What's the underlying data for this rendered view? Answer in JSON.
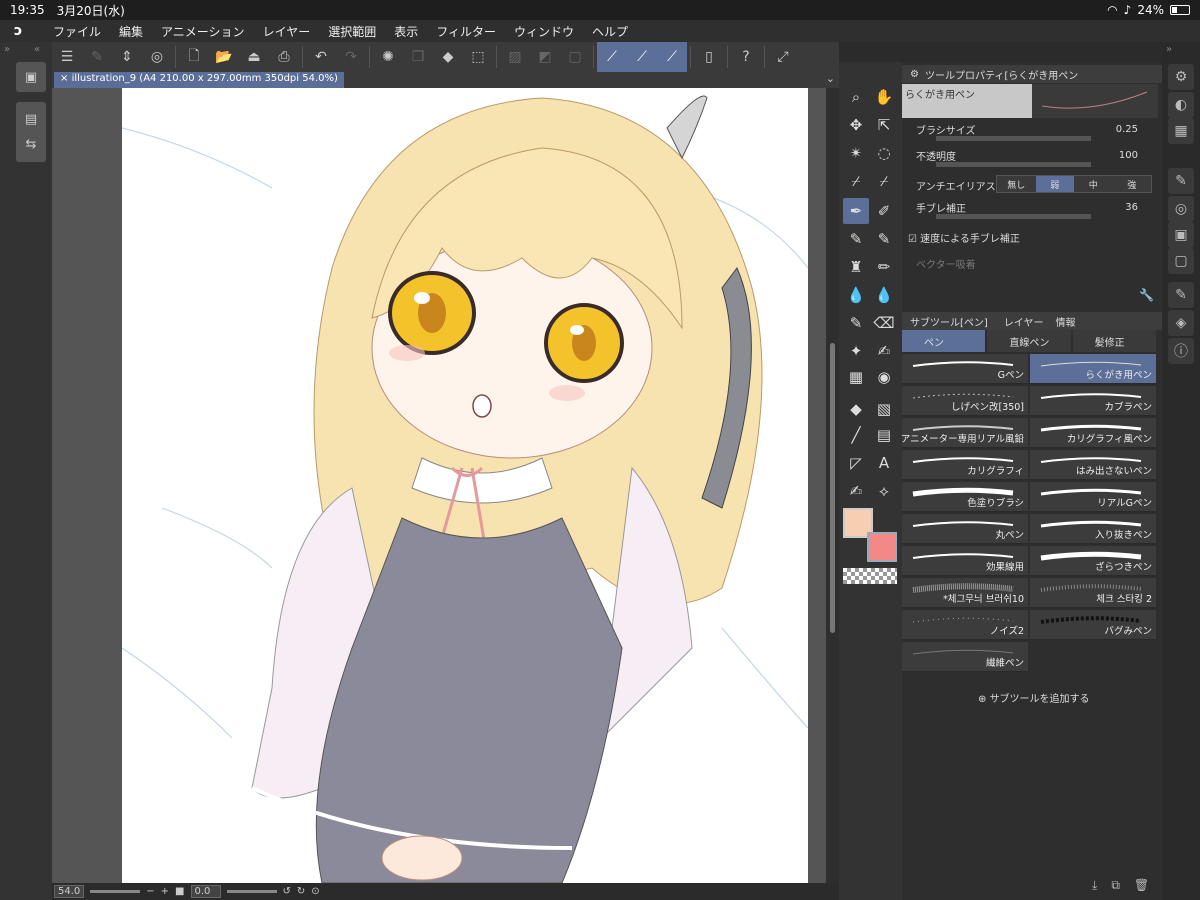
{
  "status": {
    "time": "19:35",
    "date": "3月20日(水)",
    "battery": "24%"
  },
  "menu": [
    "ファイル",
    "編集",
    "アニメーション",
    "レイヤー",
    "選択範囲",
    "表示",
    "フィルター",
    "ウィンドウ",
    "ヘルプ"
  ],
  "document": {
    "tab_label": "illustration_9 (A4 210.00 x 297.00mm 350dpi 54.0%)"
  },
  "bottom": {
    "zoom": "54.0",
    "angle": "0.0"
  },
  "tool_property": {
    "title": "ツールプロパティ[らくがき用ペン",
    "preset_name": "らくがき用ペン",
    "brush_size_label": "ブラシサイズ",
    "brush_size_value": "0.25",
    "opacity_label": "不透明度",
    "opacity_value": "100",
    "antialias_label": "アンチエイリアス",
    "antialias_options": [
      "無し",
      "弱",
      "中",
      "強"
    ],
    "stabilization_label": "手ブレ補正",
    "stabilization_value": "36",
    "speed_stab_label": "速度による手ブレ補正",
    "vector_snap_label": "ベクター吸着"
  },
  "subtool": {
    "header": "サブツール[ペン]",
    "layer_tab": "レイヤー",
    "info_tab": "情報",
    "tabs": [
      "ペン",
      "直線ペン",
      "髪修正"
    ],
    "brushes": [
      "Gペン",
      "らくがき用ペン",
      "しげペン改[350]",
      "カブラペン",
      "アニメーター専用リアル風鉛",
      "カリグラフィ風ペン",
      "カリグラフィ",
      "はみ出さないペン",
      "色塗りブラシ",
      "リアルGペン",
      "丸ペン",
      "入り抜きペン",
      "効果線用",
      "ざらつきペン",
      "*체그무늬 브러쉬10",
      "체크 스타킹 2",
      "ノイズ2",
      "バグみペン",
      "繊維ペン"
    ],
    "add_label": "サブツールを追加する"
  },
  "colors": {
    "main": "#f6cfb3",
    "sub": "#f28888",
    "accent": "#5b6f99"
  }
}
